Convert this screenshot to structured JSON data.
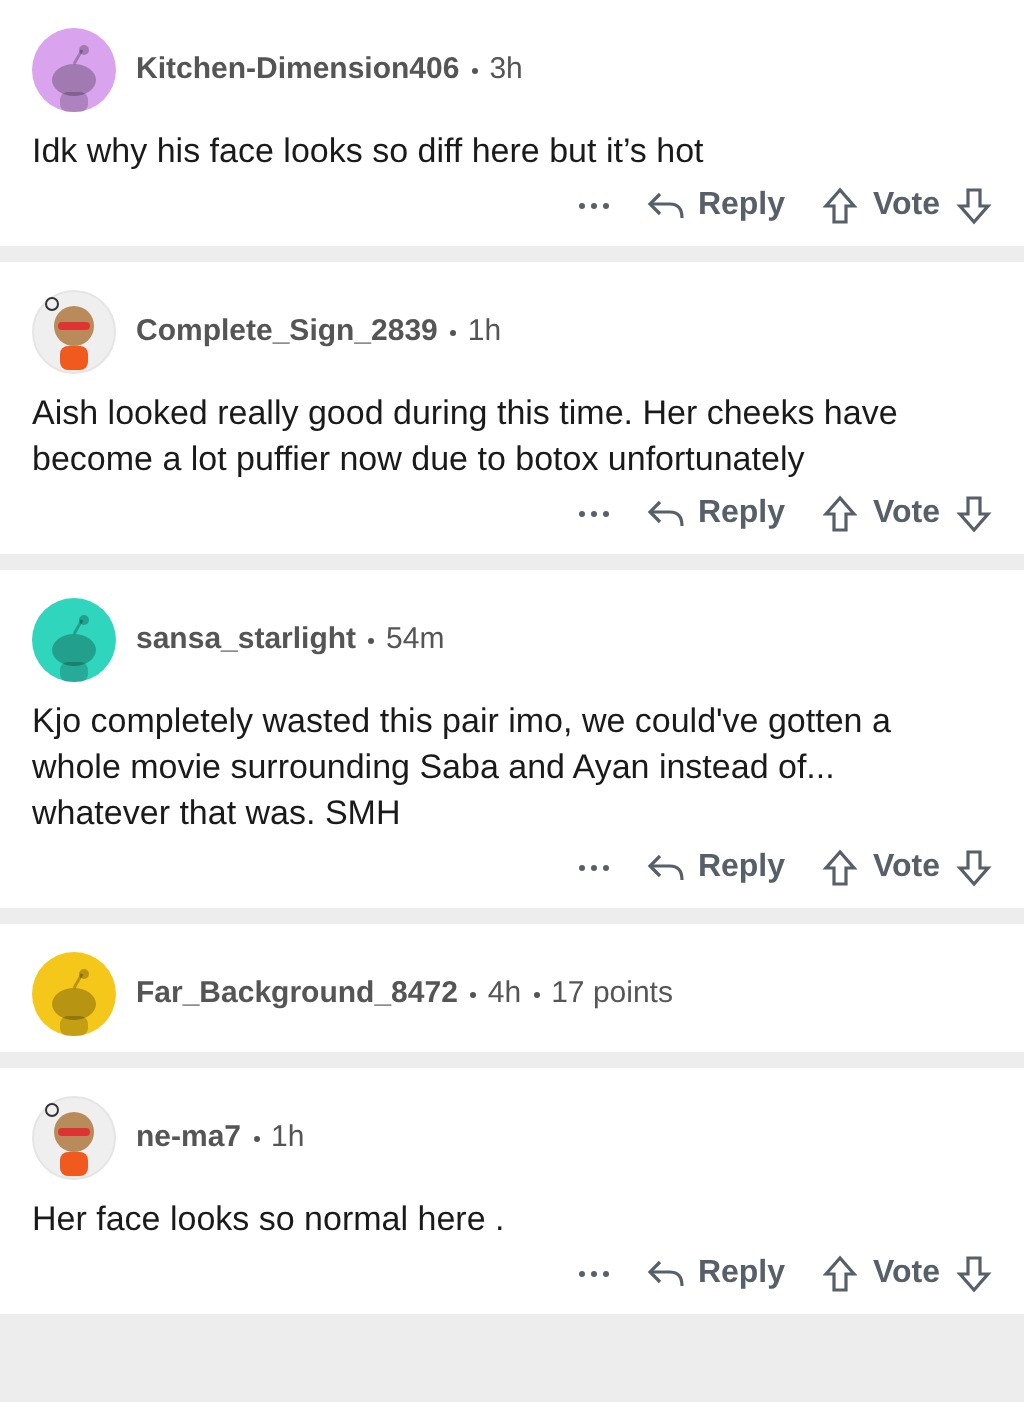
{
  "comments": [
    {
      "author": "Kitchen-Dimension406",
      "meta": [
        "3h"
      ],
      "avatar": {
        "kind": "snoo",
        "color": "#d9a3ee"
      },
      "body": "Idk why his face looks so diff here but it’s hot",
      "actions": {
        "reply": "Reply",
        "vote": "Vote"
      }
    },
    {
      "author": "Complete_Sign_2839",
      "meta": [
        "1h"
      ],
      "avatar": {
        "kind": "custom"
      },
      "body": "Aish looked really good during this time. Her cheeks have become a lot puffier now due to botox unfortunately",
      "actions": {
        "reply": "Reply",
        "vote": "Vote"
      }
    },
    {
      "author": "sansa_starlight",
      "meta": [
        "54m"
      ],
      "avatar": {
        "kind": "snoo",
        "color": "#2fd6bd"
      },
      "body": "Kjo completely wasted this pair imo, we could've gotten a whole movie surrounding Saba and Ayan instead of... whatever that was. SMH",
      "actions": {
        "reply": "Reply",
        "vote": "Vote"
      }
    },
    {
      "author": "Far_Background_8472",
      "meta": [
        "4h",
        "17 points"
      ],
      "avatar": {
        "kind": "snoo",
        "color": "#f5c71a"
      }
    },
    {
      "author": "ne-ma7",
      "meta": [
        "1h"
      ],
      "avatar": {
        "kind": "custom"
      },
      "body": "Her face looks so normal here .",
      "actions": {
        "reply": "Reply",
        "vote": "Vote"
      }
    }
  ]
}
